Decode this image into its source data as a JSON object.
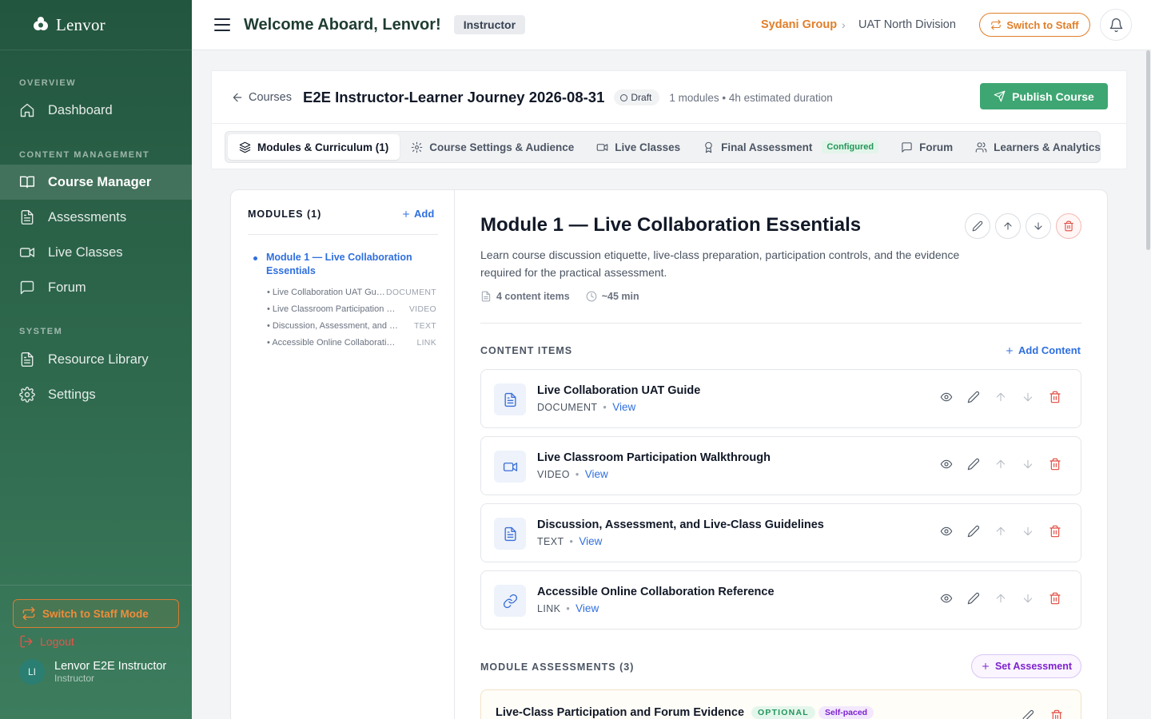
{
  "sidebar": {
    "brand": "Lenvor",
    "sections": {
      "overview": "OVERVIEW",
      "content": "CONTENT MANAGEMENT",
      "system": "SYSTEM"
    },
    "items": {
      "dashboard": "Dashboard",
      "course_manager": "Course Manager",
      "assessments": "Assessments",
      "live_classes": "Live Classes",
      "forum": "Forum",
      "resource_library": "Resource Library",
      "settings": "Settings"
    },
    "switch_staff": "Switch to Staff Mode",
    "logout": "Logout",
    "user": {
      "initials": "LI",
      "name": "Lenvor E2E Instructor",
      "role": "Instructor"
    }
  },
  "header": {
    "welcome": "Welcome Aboard, Lenvor!",
    "role_badge": "Instructor",
    "org": "Sydani Group",
    "division": "UAT North Division",
    "switch_staff": "Switch to Staff"
  },
  "course": {
    "back_label": "Courses",
    "title": "E2E Instructor-Learner Journey 2026-08-31",
    "status": "Draft",
    "meta": "1 modules • 4h estimated duration",
    "publish_label": "Publish Course",
    "tabs": {
      "modules": "Modules & Curriculum (1)",
      "settings": "Course Settings & Audience",
      "live": "Live Classes",
      "final": "Final Assessment",
      "final_badge": "Configured",
      "forum": "Forum",
      "learners": "Learners & Analytics"
    }
  },
  "modules_panel": {
    "title": "MODULES (1)",
    "add_label": "Add",
    "module_name": "Module 1 — Live Collaboration Essentials",
    "items": [
      {
        "name": "Live Collaboration UAT Guide",
        "type": "DOCUMENT"
      },
      {
        "name": "Live Classroom Participation Walkthrough",
        "type": "VIDEO"
      },
      {
        "name": "Discussion, Assessment, and Live-Class Guidelines",
        "type": "TEXT"
      },
      {
        "name": "Accessible Online Collaboration Reference",
        "type": "LINK"
      }
    ]
  },
  "module_detail": {
    "title": "Module 1 — Live Collaboration Essentials",
    "description": "Learn course discussion etiquette, live-class preparation, participation controls, and the evidence required for the practical assessment.",
    "content_count": "4 content items",
    "duration": "~45 min",
    "content_items_title": "CONTENT ITEMS",
    "add_content_label": "Add Content",
    "view_label": "View",
    "content_items": [
      {
        "name": "Live Collaboration UAT Guide",
        "type": "DOCUMENT",
        "icon": "document-icon"
      },
      {
        "name": "Live Classroom Participation Walkthrough",
        "type": "VIDEO",
        "icon": "video-icon"
      },
      {
        "name": "Discussion, Assessment, and Live-Class Guidelines",
        "type": "TEXT",
        "icon": "text-icon"
      },
      {
        "name": "Accessible Online Collaboration Reference",
        "type": "LINK",
        "icon": "link-icon"
      }
    ],
    "assessments_title": "MODULE ASSESSMENTS (3)",
    "set_assessment_label": "Set Assessment",
    "assessments": [
      {
        "name": "Live-Class Participation and Forum Evidence",
        "badge": "OPTIONAL",
        "mode": "Self-paced"
      }
    ]
  },
  "colors": {
    "sidebar": "#2f6a4e",
    "accent_orange": "#e07f2a",
    "primary_blue": "#2f6fde",
    "publish_green": "#3ea672",
    "danger": "#e0473c"
  }
}
